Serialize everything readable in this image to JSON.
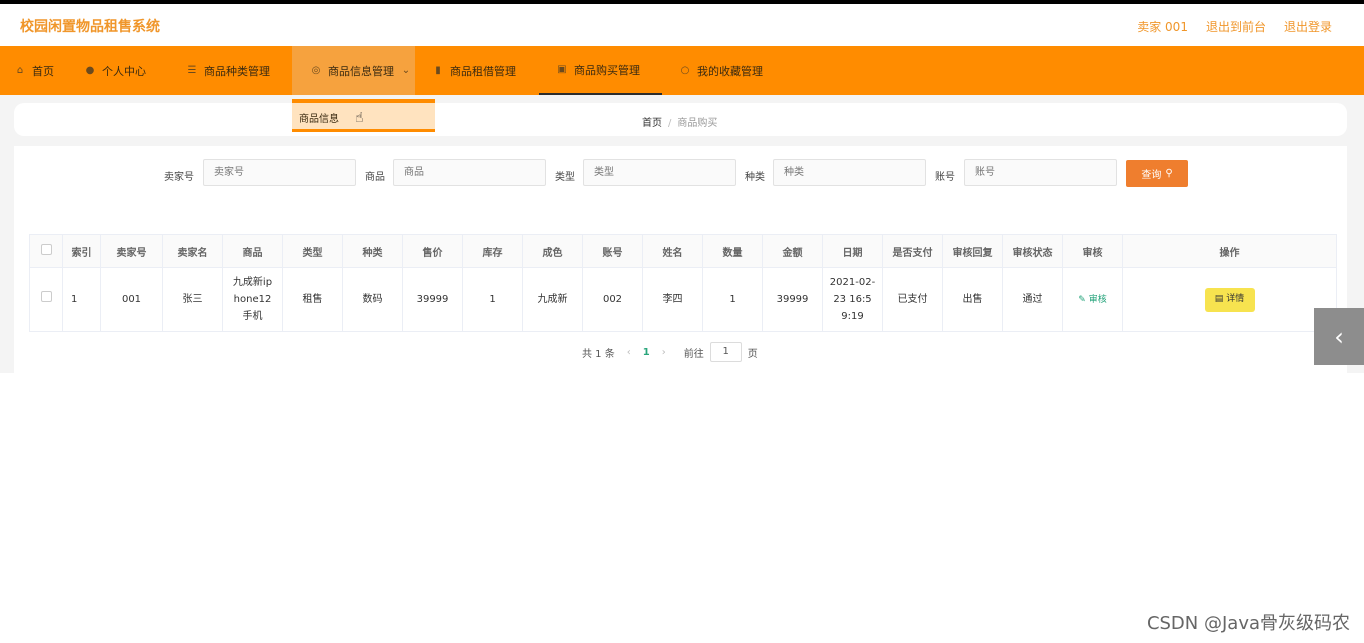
{
  "header": {
    "title": "校园闲置物品租售系统",
    "user_label": "卖家 001",
    "exit_front": "退出到前台",
    "logout": "退出登录"
  },
  "nav": {
    "items": [
      {
        "label": "首页",
        "icon": "home-icon"
      },
      {
        "label": "个人中心",
        "icon": "user-icon"
      },
      {
        "label": "商品种类管理",
        "icon": "list-icon"
      },
      {
        "label": "商品信息管理",
        "icon": "compass-icon"
      },
      {
        "label": "商品租借管理",
        "icon": "clipboard-icon"
      },
      {
        "label": "商品购买管理",
        "icon": "picture-icon"
      },
      {
        "label": "我的收藏管理",
        "icon": "circle-icon"
      }
    ],
    "dropdown_item": "商品信息"
  },
  "breadcrumb": {
    "home": "首页",
    "separator": "/",
    "current": "商品购买"
  },
  "search": {
    "fields": [
      {
        "label": "卖家号",
        "placeholder": "卖家号"
      },
      {
        "label": "商品",
        "placeholder": "商品"
      },
      {
        "label": "类型",
        "placeholder": "类型"
      },
      {
        "label": "种类",
        "placeholder": "种类"
      },
      {
        "label": "账号",
        "placeholder": "账号"
      }
    ],
    "button_label": "查询"
  },
  "table": {
    "headers": [
      "索引",
      "卖家号",
      "卖家名",
      "商品",
      "类型",
      "种类",
      "售价",
      "库存",
      "成色",
      "账号",
      "姓名",
      "数量",
      "金额",
      "日期",
      "是否支付",
      "审核回复",
      "审核状态",
      "审核",
      "操作"
    ],
    "rows": [
      {
        "index": "1",
        "seller_no": "001",
        "seller_name": "张三",
        "product": "九成新iphone12手机",
        "type": "租售",
        "category": "数码",
        "price": "39999",
        "stock": "1",
        "condition": "九成新",
        "account": "002",
        "name": "李四",
        "quantity": "1",
        "amount": "39999",
        "date": "2021-02-23 16:59:19",
        "paid": "已支付",
        "audit_reply": "出售",
        "audit_status": "通过",
        "audit_action": "审核",
        "detail_label": "详情"
      }
    ]
  },
  "pagination": {
    "total": "共 1 条",
    "current_page": "1",
    "goto_label": "前往",
    "goto_value": "1",
    "page_suffix": "页"
  },
  "watermark": "CSDN @Java骨灰级码农",
  "colors": {
    "brand": "#ff8c00",
    "title": "#f0962a",
    "search_button": "#ef7e2e",
    "detail_button": "#f7e34f",
    "audit_link": "#23a37a"
  }
}
